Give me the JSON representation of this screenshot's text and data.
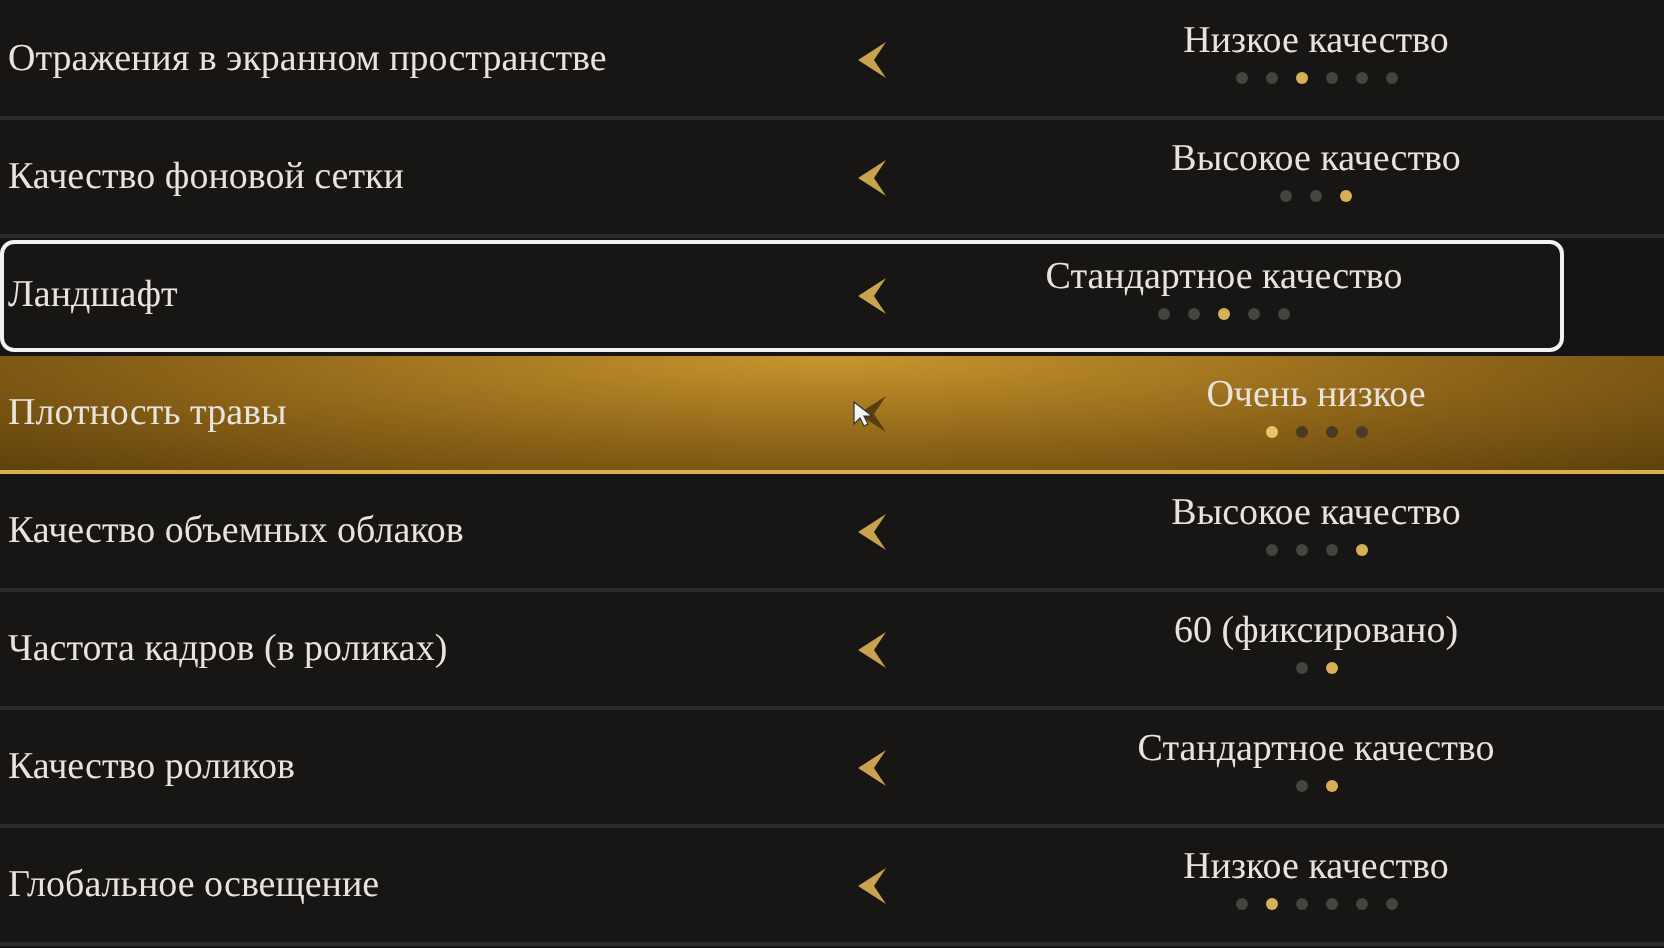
{
  "settings": [
    {
      "label": "Отражения в экранном пространстве",
      "value": "Низкое качество",
      "focused": false,
      "highlighted": false,
      "pointer": false,
      "dots": [
        {
          "selected": false
        },
        {
          "selected": false
        },
        {
          "selected": true
        },
        {
          "selected": false
        },
        {
          "selected": false
        },
        {
          "selected": false
        }
      ]
    },
    {
      "label": "Качество фоновой сетки",
      "value": "Высокое качество",
      "focused": false,
      "highlighted": false,
      "pointer": false,
      "dots": [
        {
          "selected": false
        },
        {
          "selected": false
        },
        {
          "selected": true
        }
      ]
    },
    {
      "label": "Ландшафт",
      "value": "Стандартное качество",
      "focused": true,
      "highlighted": false,
      "pointer": false,
      "dots": [
        {
          "selected": false
        },
        {
          "selected": false
        },
        {
          "selected": true
        },
        {
          "selected": false
        },
        {
          "selected": false
        }
      ]
    },
    {
      "label": "Плотность травы",
      "value": "Очень низкое",
      "focused": false,
      "highlighted": true,
      "pointer": true,
      "dots": [
        {
          "selected": true
        },
        {
          "selected": false
        },
        {
          "selected": false
        },
        {
          "selected": false
        }
      ]
    },
    {
      "label": "Качество объемных облаков",
      "value": "Высокое качество",
      "focused": false,
      "highlighted": false,
      "pointer": false,
      "dots": [
        {
          "selected": false
        },
        {
          "selected": false
        },
        {
          "selected": false
        },
        {
          "selected": true
        }
      ]
    },
    {
      "label": "Частота кадров (в роликах)",
      "value": "60 (фиксировано)",
      "focused": false,
      "highlighted": false,
      "pointer": false,
      "dots": [
        {
          "selected": false
        },
        {
          "selected": true
        }
      ]
    },
    {
      "label": "Качество роликов",
      "value": "Стандартное качество",
      "focused": false,
      "highlighted": false,
      "pointer": false,
      "dots": [
        {
          "selected": false
        },
        {
          "selected": true
        }
      ]
    },
    {
      "label": "Глобальное освещение",
      "value": "Низкое качество",
      "focused": false,
      "highlighted": false,
      "pointer": false,
      "dots": [
        {
          "selected": false
        },
        {
          "selected": true
        },
        {
          "selected": false
        },
        {
          "selected": false
        },
        {
          "selected": false
        },
        {
          "selected": false
        }
      ]
    }
  ]
}
